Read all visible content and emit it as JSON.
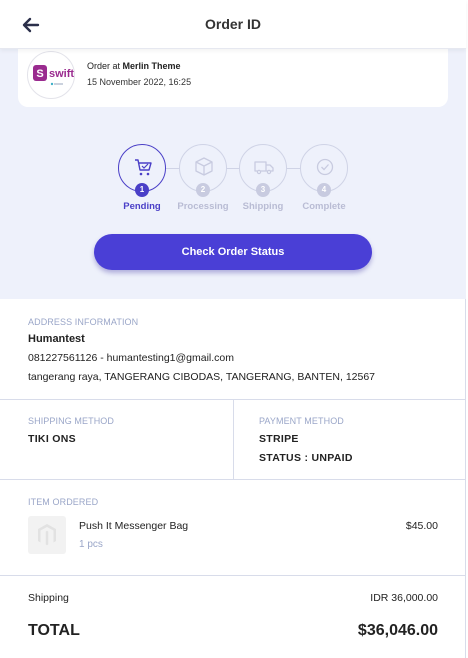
{
  "header": {
    "title": "Order ID",
    "back_icon": "arrow-left-icon"
  },
  "order": {
    "store_logo_text": "swift",
    "order_at_prefix": "Order at",
    "store_name": "Merlin Theme",
    "date": "15 November 2022, 16:25"
  },
  "steps": [
    {
      "num": "1",
      "label": "Pending",
      "icon": "cart-icon",
      "active": true
    },
    {
      "num": "2",
      "label": "Processing",
      "icon": "box-icon",
      "active": false
    },
    {
      "num": "3",
      "label": "Shipping",
      "icon": "truck-icon",
      "active": false
    },
    {
      "num": "4",
      "label": "Complete",
      "icon": "check-circle-icon",
      "active": false
    }
  ],
  "check_status_label": "Check Order Status",
  "address": {
    "section_label": "ADDRESS INFORMATION",
    "name": "Humantest",
    "contact": "081227561126 - humantesting1@gmail.com",
    "line": "tangerang raya, TANGERANG CIBODAS, TANGERANG, BANTEN, 12567"
  },
  "shipping_method": {
    "section_label": "SHIPPING METHOD",
    "value": "TIKI ONS"
  },
  "payment_method": {
    "section_label": "PAYMENT METHOD",
    "value": "STRIPE",
    "status": "STATUS : UNPAID"
  },
  "items": {
    "section_label": "ITEM ORDERED",
    "list": [
      {
        "name": "Push It Messenger Bag",
        "qty": "1 pcs",
        "price": "$45.00"
      }
    ]
  },
  "totals": {
    "shipping_label": "Shipping",
    "shipping_value": "IDR 36,000.00",
    "total_label": "TOTAL",
    "total_value": "$36,046.00"
  },
  "colors": {
    "accent": "#4a3fd6",
    "background_top": "#eef1fb",
    "muted_label": "#9aa6c8",
    "inactive_step": "#c8cbe0"
  }
}
